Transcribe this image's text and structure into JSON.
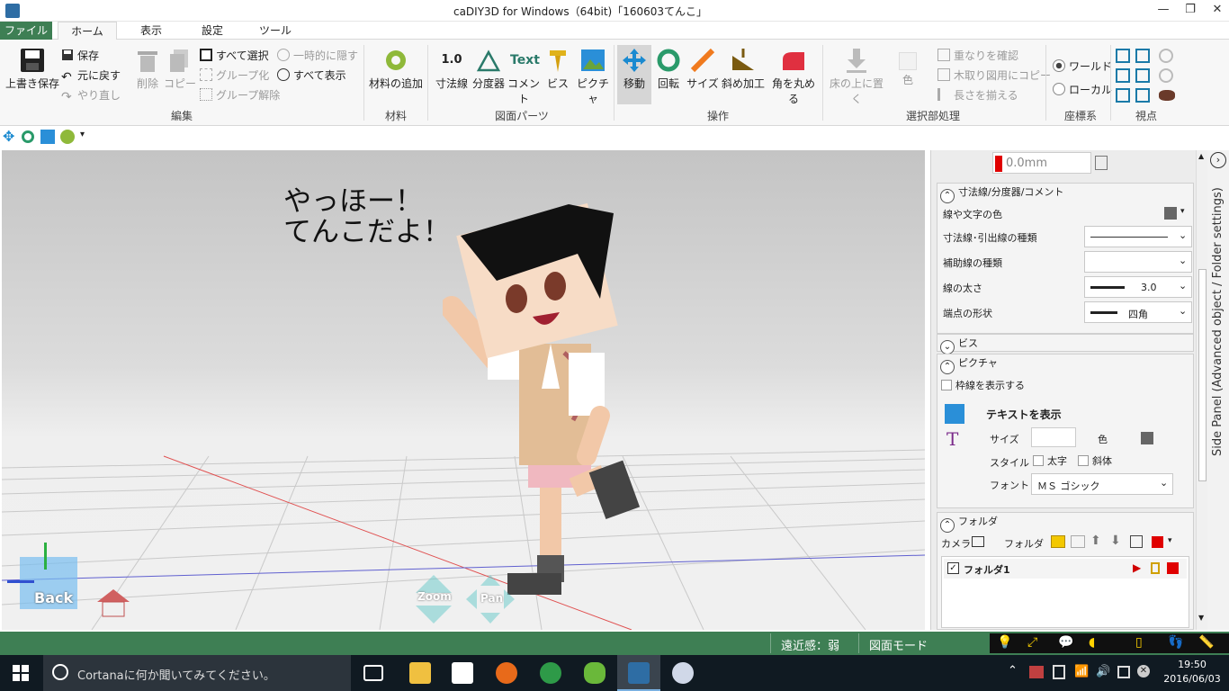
{
  "window": {
    "title": "caDIY3D for Windows（64bit)「160603てんこ」",
    "minimize": "—",
    "maximize": "❐",
    "close": "✕"
  },
  "tabs": [
    {
      "label": "ファイル"
    },
    {
      "label": "ホーム"
    },
    {
      "label": "表示"
    },
    {
      "label": "設定"
    },
    {
      "label": "ツール"
    }
  ],
  "ribbon": {
    "groups": {
      "edit": "編集",
      "material": "材料",
      "drawing_parts": "図面パーツ",
      "operation": "操作",
      "selection": "選択部処理",
      "coords": "座標系",
      "viewpoint": "視点"
    },
    "overwrite_save": "上書き保存",
    "save": "保存",
    "undo": "元に戻す",
    "redo": "やり直し",
    "delete": "削除",
    "copy": "コピー",
    "select_all": "すべて選択",
    "group": "グループ化",
    "ungroup": "グループ解除",
    "hide_temp": "一時的に隠す",
    "show_all": "すべて表示",
    "add_material": "材料の追加",
    "dimension": "寸法線",
    "protractor": "分度器",
    "comment": "コメント",
    "screw": "ビス",
    "picture": "ピクチャ",
    "move": "移動",
    "rotate": "回転",
    "size": "サイズ",
    "bevel": "斜め加工",
    "round": "角を丸める",
    "place_floor": "床の上に置く",
    "color": "色",
    "check_overlap": "重なりを確認",
    "cut_copy": "木取り図用にコピー",
    "align_length": "長さを揃える",
    "world": "ワールド",
    "local": "ローカル",
    "dim_icon_text": "1.0",
    "text_icon_text": "Text"
  },
  "viewport": {
    "speech_line1": "やっほー！",
    "speech_line2": "てんこだよ！",
    "back": "Back",
    "zoom": "Zoom",
    "pan": "Pan"
  },
  "side_panel": {
    "vertical_label": "Side Panel (Advanced object / Folder settings)",
    "top_value": "0.0mm",
    "dim_section": "寸法線/分度器/コメント",
    "line_text_color": "線や文字の色",
    "line_type": "寸法線･引出線の種類",
    "aux_line_type": "補助線の種類",
    "line_width": "線の太さ",
    "line_width_value": "3.0",
    "end_shape": "端点の形状",
    "end_shape_value": "四角",
    "screw_section": "ビス",
    "picture_section": "ピクチャ",
    "show_frame": "枠線を表示する",
    "show_text": "テキストを表示",
    "size_label": "サイズ",
    "color_label": "色",
    "style_label": "スタイル",
    "bold": "太字",
    "italic": "斜体",
    "font_label": "フォント",
    "font_value": "ＭＳ ゴシック",
    "folder_section": "フォルダ",
    "camera": "カメラ",
    "folder": "フォルダ",
    "folder1": "フォルダ1"
  },
  "statusbar": {
    "perspective": "遠近感：弱",
    "mode": "図面モード"
  },
  "taskbar": {
    "cortana": "Cortanaに何か聞いてみてください。",
    "time": "19:50",
    "date": "2016/06/03"
  },
  "colors": {
    "accent_green": "#3e7f54",
    "red_swatch": "#e00000",
    "icon_blue": "#2a8fd8",
    "icon_orange": "#f07a1e",
    "icon_green": "#6aa43a"
  }
}
